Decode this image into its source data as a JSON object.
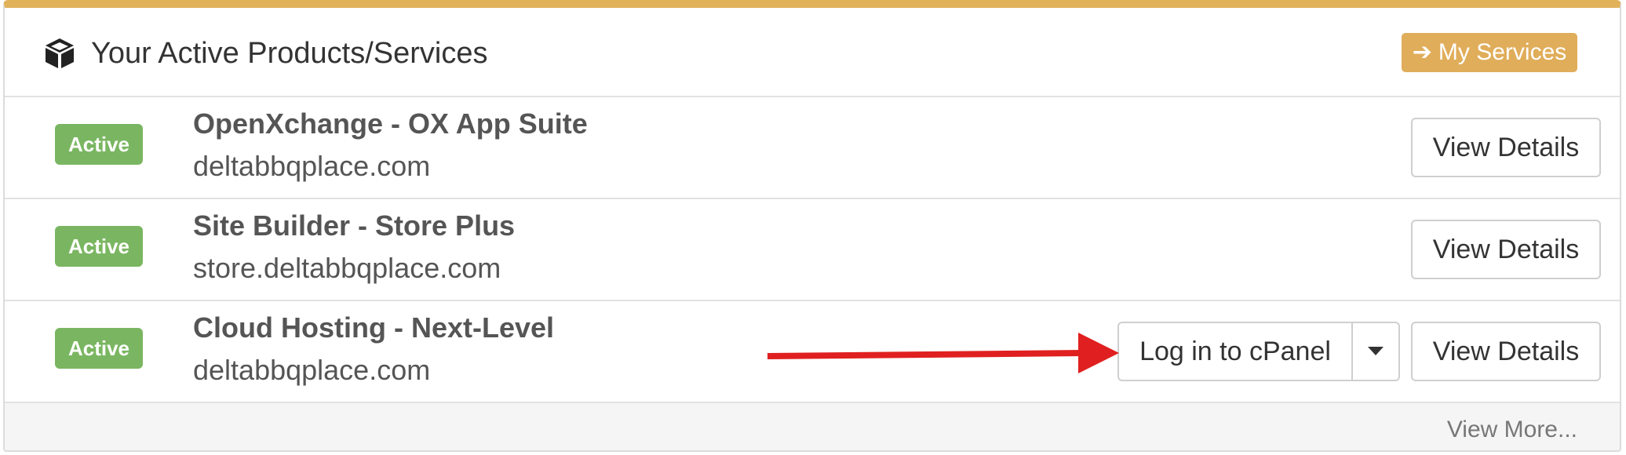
{
  "panel": {
    "title": "Your Active Products/Services",
    "header_icon": "cube-icon",
    "my_services_button": {
      "icon": "arrow-right-icon",
      "label": "My Services"
    },
    "accent_color": "#e0b25a"
  },
  "products": [
    {
      "status": "Active",
      "name": "OpenXchange - OX App Suite",
      "domain": "deltabbqplace.com",
      "view_details_label": "View Details"
    },
    {
      "status": "Active",
      "name": "Site Builder - Store Plus",
      "domain": "store.deltabbqplace.com",
      "view_details_label": "View Details"
    },
    {
      "status": "Active",
      "name": "Cloud Hosting - Next-Level",
      "domain": "deltabbqplace.com",
      "login_label": "Log in to cPanel",
      "view_details_label": "View Details"
    }
  ],
  "footer": {
    "view_more_label": "View More..."
  },
  "colors": {
    "status_active": "#7ab661",
    "button_orange": "#e0ad5a",
    "annotation_arrow": "#e02020"
  }
}
